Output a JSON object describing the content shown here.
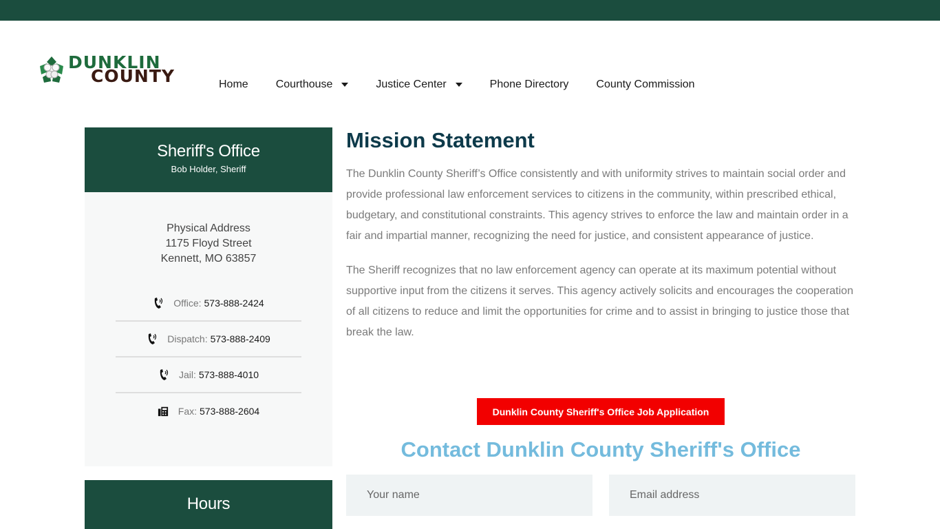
{
  "brand": {
    "line1": "DUNKLIN",
    "line2": "COUNTY"
  },
  "nav": {
    "items": [
      {
        "label": "Home"
      },
      {
        "label": "Courthouse"
      },
      {
        "label": "Justice Center"
      },
      {
        "label": "Phone Directory"
      },
      {
        "label": "County Commission"
      }
    ]
  },
  "sidebar": {
    "title": "Sheriff's Office",
    "subtitle": "Bob Holder, Sheriff",
    "address": {
      "label": "Physical Address",
      "street": "1175 Floyd Street",
      "city": "Kennett, MO 63857"
    },
    "contacts": [
      {
        "label": "Office:",
        "value": "573-888-2424",
        "icon": "phone-icon"
      },
      {
        "label": "Dispatch:",
        "value": "573-888-2409",
        "icon": "phone-icon"
      },
      {
        "label": "Jail:",
        "value": "573-888-4010",
        "icon": "phone-icon"
      },
      {
        "label": "Fax:",
        "value": "573-888-2604",
        "icon": "fax-icon"
      }
    ],
    "hours_title": "Hours"
  },
  "main": {
    "mission_title": "Mission Statement",
    "paragraph1": "The Dunklin County Sheriff’s Office consistently and with uniformity strives to maintain social order and provide professional law enforcement services to citizens in the community, within prescribed ethical, budgetary, and constitutional constraints. This agency strives to enforce the law and maintain order in a fair and impartial manner, recognizing the need for justice, and consistent appearance of justice.",
    "paragraph2": "The Sheriff recognizes that no law enforcement agency can operate at its maximum potential without supportive input from the citizens it serves. This agency actively solicits and encourages the cooperation of all citizens to reduce and limit the opportunities for crime and to assist in bringing to justice those that break the law.",
    "apply_button": "Dunklin County Sheriff's Office Job Application",
    "contact_title": "Contact Dunklin County Sheriff's Office"
  },
  "form": {
    "name_placeholder": "Your name",
    "email_placeholder": "Email address"
  },
  "colors": {
    "brand_green": "#1b4d3e",
    "accent_red": "#f20000",
    "heading_blue": "#74bbdd",
    "heading_dark": "#0d3a4a"
  }
}
